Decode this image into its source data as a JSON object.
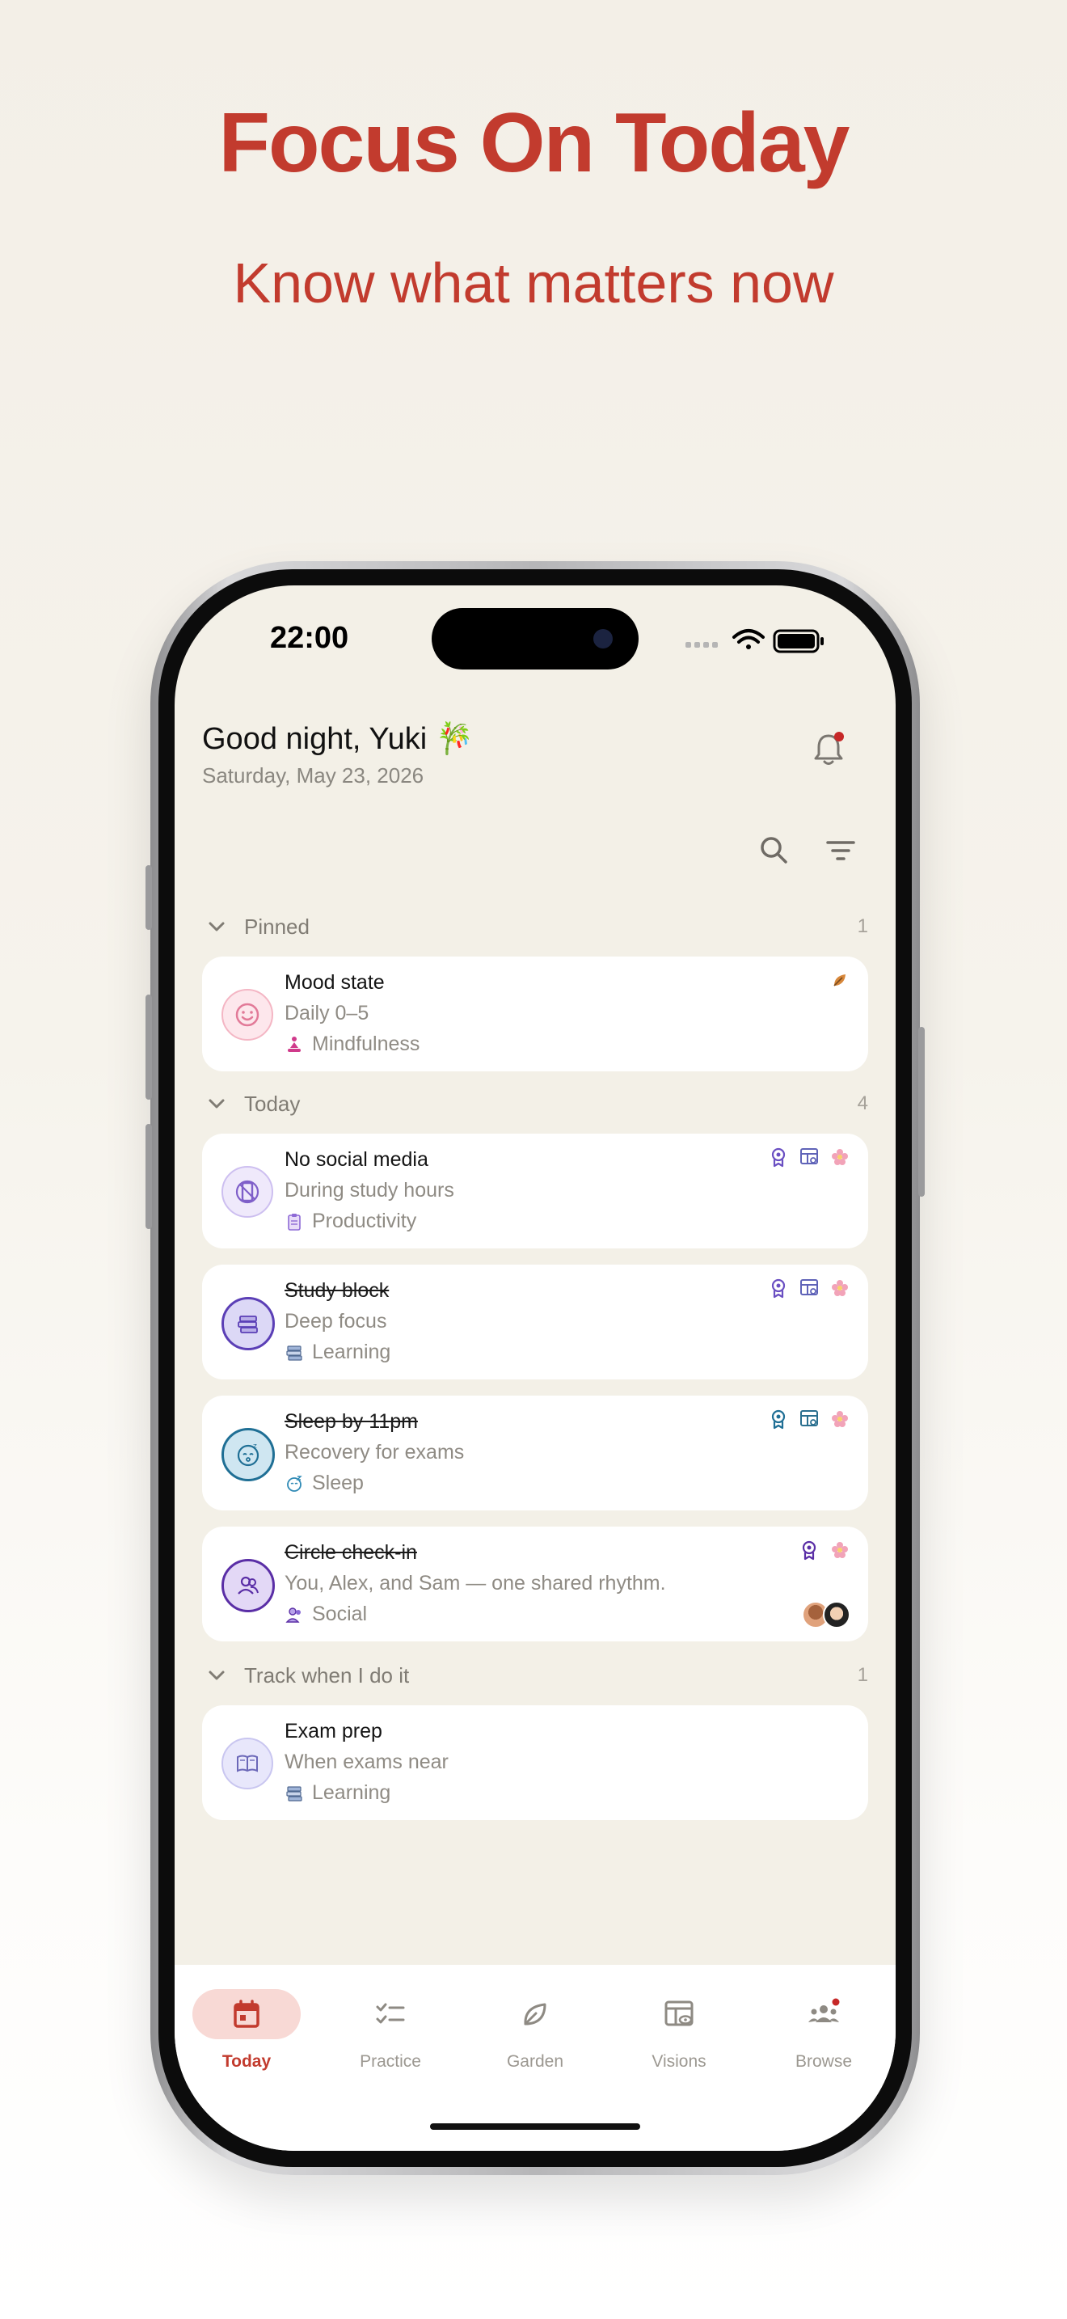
{
  "promo": {
    "headline": "Focus On Today",
    "subline": "Know what matters now"
  },
  "status_bar": {
    "time": "22:00"
  },
  "header": {
    "greeting": "Good night, Yuki 🎋",
    "date": "Saturday, May 23, 2026",
    "notification_dot": true
  },
  "toolbar": {
    "search_icon": "search-icon",
    "filter_icon": "filter-icon"
  },
  "sections": [
    {
      "title": "Pinned",
      "count": "1",
      "items": [
        {
          "title": "Mood state",
          "subtitle": "Daily 0–5",
          "category": "Mindfulness",
          "completed": false,
          "badges": [
            "leaf-icon"
          ],
          "icon": "smiley-icon"
        }
      ]
    },
    {
      "title": "Today",
      "count": "4",
      "items": [
        {
          "title": "No social media",
          "subtitle": "During study hours",
          "category": "Productivity",
          "completed": false,
          "badges": [
            "award-icon",
            "vision-board-icon",
            "flower-icon"
          ],
          "icon": "no-phone-icon"
        },
        {
          "title": "Study block",
          "subtitle": "Deep focus",
          "category": "Learning",
          "completed": true,
          "badges": [
            "award-icon",
            "vision-board-icon",
            "flower-icon"
          ],
          "icon": "books-icon"
        },
        {
          "title": "Sleep by 11pm",
          "subtitle": "Recovery for exams",
          "category": "Sleep",
          "completed": true,
          "badges": [
            "award-icon",
            "vision-board-icon",
            "flower-icon"
          ],
          "icon": "sleep-icon"
        },
        {
          "title": "Circle check-in",
          "subtitle": "You, Alex, and Sam — one shared rhythm.",
          "category": "Social",
          "completed": true,
          "badges": [
            "award-icon",
            "flower-icon"
          ],
          "icon": "people-icon"
        }
      ]
    },
    {
      "title": "Track when I do it",
      "count": "1",
      "items": [
        {
          "title": "Exam prep",
          "subtitle": "When exams near",
          "category": "Learning",
          "completed": false,
          "badges": [],
          "icon": "book-icon"
        }
      ]
    }
  ],
  "nav": [
    {
      "label": "Today",
      "icon": "calendar-icon",
      "active": true
    },
    {
      "label": "Practice",
      "icon": "checklist-icon",
      "active": false
    },
    {
      "label": "Garden",
      "icon": "leaf-icon",
      "active": false
    },
    {
      "label": "Visions",
      "icon": "vision-board-icon",
      "active": false
    },
    {
      "label": "Browse",
      "icon": "group-icon",
      "active": false,
      "dot": true
    }
  ],
  "colors": {
    "brand": "#c23b2e",
    "background": "#f3f0e7",
    "card": "#ffffff",
    "muted": "#8f8b84"
  }
}
